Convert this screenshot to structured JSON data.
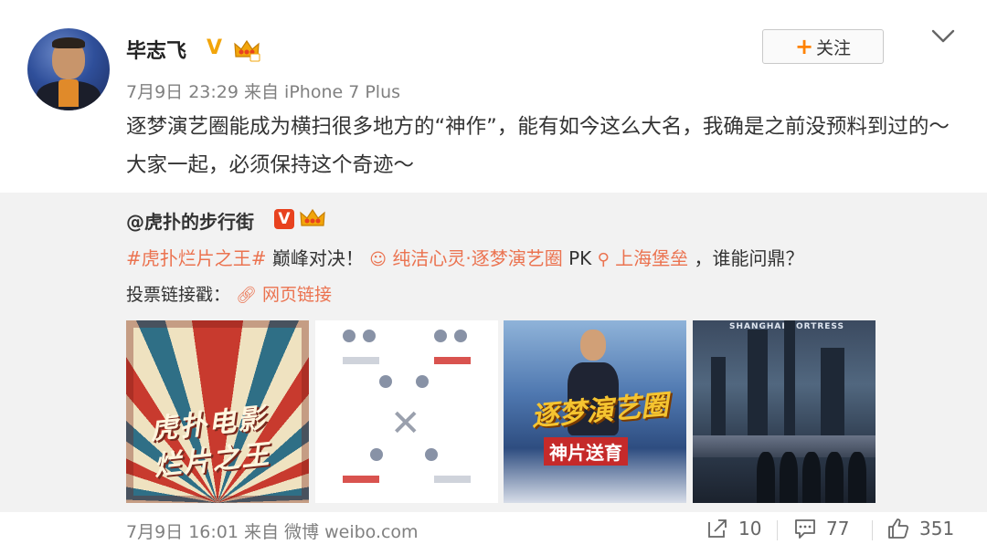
{
  "post": {
    "username": "毕志飞",
    "verified_badge": "V",
    "meta": "7月9日 23:29 来自 iPhone 7 Plus",
    "follow_label": "关注",
    "text": "逐梦演艺圈能成为横扫很多地方的“神作”，能有如今这么大名，我确是之前没预料到过的～大家一起，必须保持这个奇迹～"
  },
  "repost": {
    "username": "@虎扑的步行街",
    "verified_badge": "V",
    "hashtag": "#虎扑烂片之王#",
    "text_1": " 巅峰对决！ ",
    "link_1": "纯洁心灵·逐梦演艺圈",
    "text_2": " PK ",
    "link_2": "上海堡垒",
    "text_3": " ，谁能问鼎？",
    "vote_label": "投票链接戳：",
    "web_link": "网页链接",
    "images": [
      {
        "name": "虎扑电影烂片之王 poster",
        "text": "虎扑电影 烂片之王"
      },
      {
        "name": "vote bracket chart"
      },
      {
        "name": "逐梦演艺圈 poster",
        "text": "逐梦演艺圈",
        "subtext": "神片送育"
      },
      {
        "name": "上海堡垒 poster",
        "text": "SHANGHAI FORTRESS"
      }
    ],
    "footer_meta": "7月9日 16:01 来自 微博 weibo.com",
    "stats": {
      "reposts": "10",
      "comments": "77",
      "likes": "351"
    }
  },
  "colors": {
    "accent_orange": "#ff8200",
    "link": "#eb7350",
    "badge_gold": "#f2a50b",
    "badge_red": "#e8421f"
  },
  "icons": [
    "chevron-down-icon",
    "crown-icon",
    "emoji-link-icon",
    "location-icon",
    "link-icon",
    "repost-icon",
    "comment-icon",
    "like-icon"
  ]
}
